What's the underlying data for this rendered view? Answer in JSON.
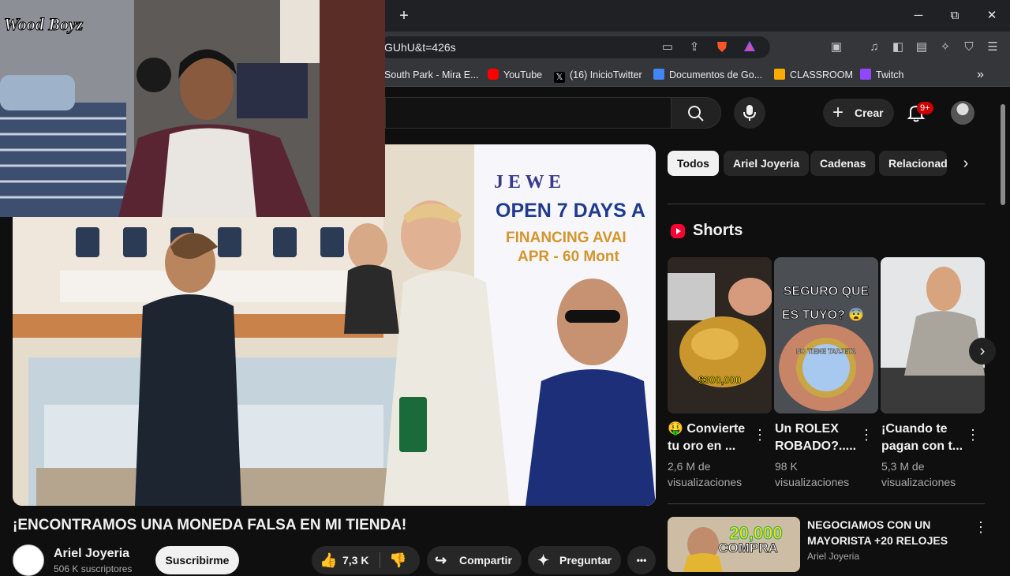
{
  "browser": {
    "url_fragment": "GUhU&t=426s",
    "new_tab": "+",
    "window_controls": {
      "minimize": "─",
      "maximize": "⧉",
      "close": "✕"
    },
    "bookmarks": [
      {
        "label": "South Park - Mira E...",
        "icon": "south-park-icon",
        "color": "#4a4a4a"
      },
      {
        "label": "YouTube",
        "icon": "youtube-icon",
        "color": "#ff0000"
      },
      {
        "label": "(16) InicioTwitter",
        "icon": "x-icon",
        "color": "#000000"
      },
      {
        "label": "Documentos de Go...",
        "icon": "docs-icon",
        "color": "#4285f4"
      },
      {
        "label": "CLASSROOM",
        "icon": "classroom-icon",
        "color": "#f9ab00"
      },
      {
        "label": "Twitch",
        "icon": "twitch-icon",
        "color": "#9146ff"
      }
    ],
    "bookmarks_more": "»"
  },
  "yt_header": {
    "create_label": "Crear",
    "notifications_badge": "9+"
  },
  "webcam_logo": "Wood Boyz",
  "video": {
    "title": "¡ENCONTRAMOS UNA MONEDA FALSA EN MI TIENDA!",
    "banner_text_1": "J E W E",
    "banner_text_2": "OPEN 7 DAYS A",
    "banner_text_3": "FINANCING AVAI",
    "banner_text_4": "APR - 60 Mont",
    "channel_name": "Ariel Joyeria",
    "channel_subs": "506 K suscriptores",
    "subscribe_label": "Suscribirme",
    "likes": "7,3 K",
    "share_label": "Compartir",
    "ask_label": "Preguntar",
    "more_label": "•••"
  },
  "chips": [
    "Todos",
    "Ariel Joyeria",
    "Cadenas",
    "Relacionad"
  ],
  "shorts": {
    "section_title": "Shorts",
    "items": [
      {
        "title": "🤑 Convierte tu oro en ...",
        "views": "2,6 M de visualizaciones",
        "overlay": "$300,000"
      },
      {
        "title": "Un ROLEX ROBADO?.....",
        "views": "98 K visualizaciones",
        "overlay": "SEGURO QUE ES TUYO? 😨",
        "overlay2": "NO TIENE TARJETA"
      },
      {
        "title": "¡Cuando te pagan con t...",
        "views": "5,3 M de visualizaciones",
        "overlay": ""
      }
    ]
  },
  "recommended": {
    "title": "NEGOCIAMOS CON UN MAYORISTA +20 RELOJES",
    "channel": "Ariel Joyeria",
    "thumb_text_1": "20,000",
    "thumb_text_2": "COMPRA"
  },
  "colors": {
    "accent": "#ff0000",
    "bg": "#0f0f0f",
    "chip": "#272727"
  }
}
